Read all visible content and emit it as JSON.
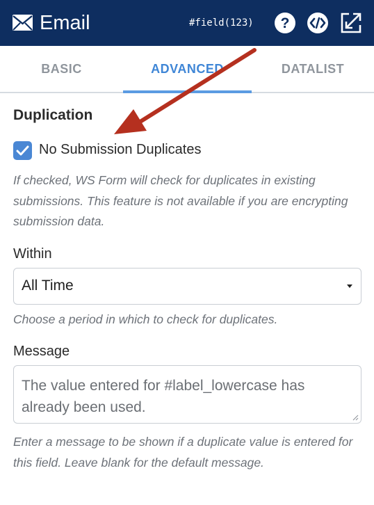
{
  "header": {
    "title": "Email",
    "shortcode": "#field(123)",
    "icons": [
      "envelope-icon",
      "help-icon",
      "code-icon",
      "expand-icon"
    ]
  },
  "tabs": [
    {
      "label": "BASIC",
      "active": false
    },
    {
      "label": "ADVANCED",
      "active": true
    },
    {
      "label": "DATALIST",
      "active": false
    }
  ],
  "section": {
    "title": "Duplication"
  },
  "duplicates": {
    "label": "No Submission Duplicates",
    "checked": true,
    "help": "If checked, WS Form will check for duplicates in existing submissions. This feature is not available if you are encrypting submission data."
  },
  "within": {
    "label": "Within",
    "selected": "All Time",
    "help": "Choose a period in which to check for duplicates."
  },
  "message": {
    "label": "Message",
    "value": "The value entered for #label_lowercase has already been used.",
    "help": "Enter a message to be shown if a duplicate value is entered for this field. Leave blank for the default message."
  },
  "colors": {
    "header_bg": "#0e2e60",
    "accent": "#3f86d6",
    "checkbox": "#4a87d4",
    "annotation_arrow": "#b5301f"
  }
}
